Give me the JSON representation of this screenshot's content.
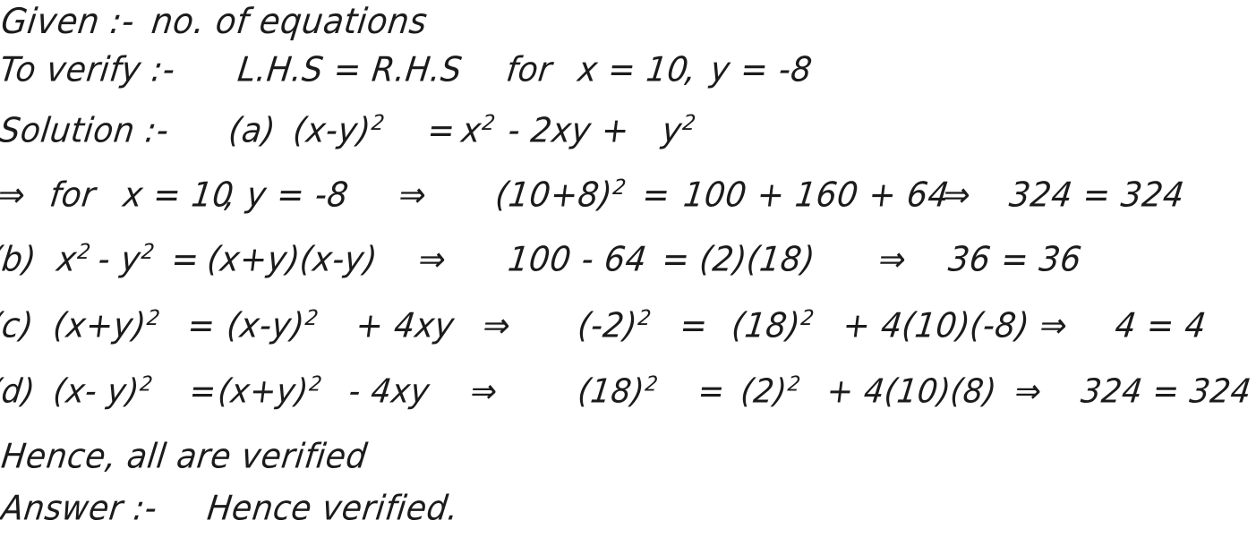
{
  "document": {
    "kind": "handwritten-math-solution",
    "topic": "Verification of algebraic identities",
    "ink_color": "#1b1b1b",
    "paper_color": "#ffffff"
  },
  "lines": {
    "given": {
      "label": "Given :-",
      "text": "no. of equations"
    },
    "to_verify": {
      "label": "To verify :-",
      "statement": "L.H.S = R.H.S",
      "condition_prefix": "for",
      "x_value": "x = 10",
      "comma": ",",
      "y_value": "y = -8"
    },
    "solution": {
      "label": "Solution :-",
      "item_a_tag": "(a)",
      "item_a_identity_lhs": "(x-y)",
      "item_a_identity_lhs_exp": "2",
      "item_a_eq": "=",
      "item_a_identity_rhs_1": "x",
      "item_a_identity_rhs_1_exp": "2",
      "item_a_identity_rhs_2": "- 2xy +",
      "item_a_identity_rhs_3": "y",
      "item_a_identity_rhs_3_exp": "2"
    },
    "substitution_a": {
      "arrow_1": "⇒",
      "prefix": "for",
      "x_value": "x = 10",
      "comma": ",",
      "y_value": "y = -8",
      "arrow_2": "⇒",
      "lhs": "(10+8)",
      "lhs_exp": "2",
      "eq": "=",
      "rhs": "100 + 160 + 64",
      "arrow_3": "⇒",
      "result": "324 = 324"
    },
    "item_b": {
      "tag": "(b)",
      "lhs_1": "x",
      "lhs_1_exp": "2",
      "lhs_2": "- y",
      "lhs_2_exp": "2",
      "eq": "=",
      "rhs": "(x+y)(x-y)",
      "arrow_1": "⇒",
      "sub_lhs": "100 - 64",
      "sub_eq": "=",
      "sub_rhs": "(2)(18)",
      "arrow_2": "⇒",
      "result": "36 = 36"
    },
    "item_c": {
      "tag": "(c)",
      "lhs": "(x+y)",
      "lhs_exp": "2",
      "eq": "=",
      "rhs_1": "(x-y)",
      "rhs_1_exp": "2",
      "rhs_2": "+ 4xy",
      "arrow_1": "⇒",
      "sub_lhs": "(-2)",
      "sub_lhs_exp": "2",
      "sub_eq": "=",
      "sub_rhs_1": "(18)",
      "sub_rhs_1_exp": "2",
      "sub_rhs_2": "+ 4(10)(-8)",
      "arrow_2": "⇒",
      "result": "4 = 4"
    },
    "item_d": {
      "tag": "(d)",
      "lhs": "(x- y)",
      "lhs_exp": "2",
      "eq": "=",
      "rhs_1": "(x+y)",
      "rhs_1_exp": "2",
      "rhs_2": "- 4xy",
      "arrow_1": "⇒",
      "sub_lhs": "(18)",
      "sub_lhs_exp": "2",
      "sub_eq": "=",
      "sub_rhs_1": "(2)",
      "sub_rhs_1_exp": "2",
      "sub_rhs_2": "+ 4(10)(8)",
      "arrow_2": "⇒",
      "result": "324 = 324"
    },
    "conclusion": {
      "text": "Hence, all are verified"
    },
    "answer": {
      "label": "Answer :-",
      "text": "Hence verified."
    }
  }
}
